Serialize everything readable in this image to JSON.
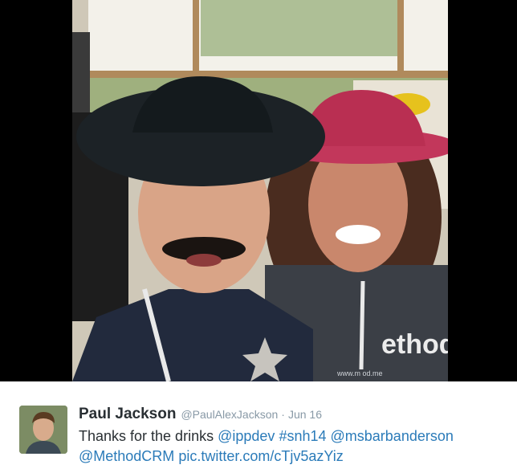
{
  "photo": {
    "description_icon": "selfie-photo",
    "shirt_text": "ethod",
    "url_text": "www.m  od.me"
  },
  "tweet": {
    "author_name": "Paul Jackson",
    "author_handle": "@PaulAlexJackson",
    "separator": "·",
    "date": "Jun 16",
    "text_plain": "Thanks for the drinks",
    "links": {
      "ippdev": "@ippdev",
      "snh14": "#snh14",
      "msbarbanderson": "@msbarbanderson",
      "methodcrm": "@MethodCRM",
      "pic": "pic.twitter.com/cTjv5azYiz"
    }
  },
  "colors": {
    "link": "#2b7bb9",
    "name": "#292f33",
    "meta": "#8899a6"
  }
}
